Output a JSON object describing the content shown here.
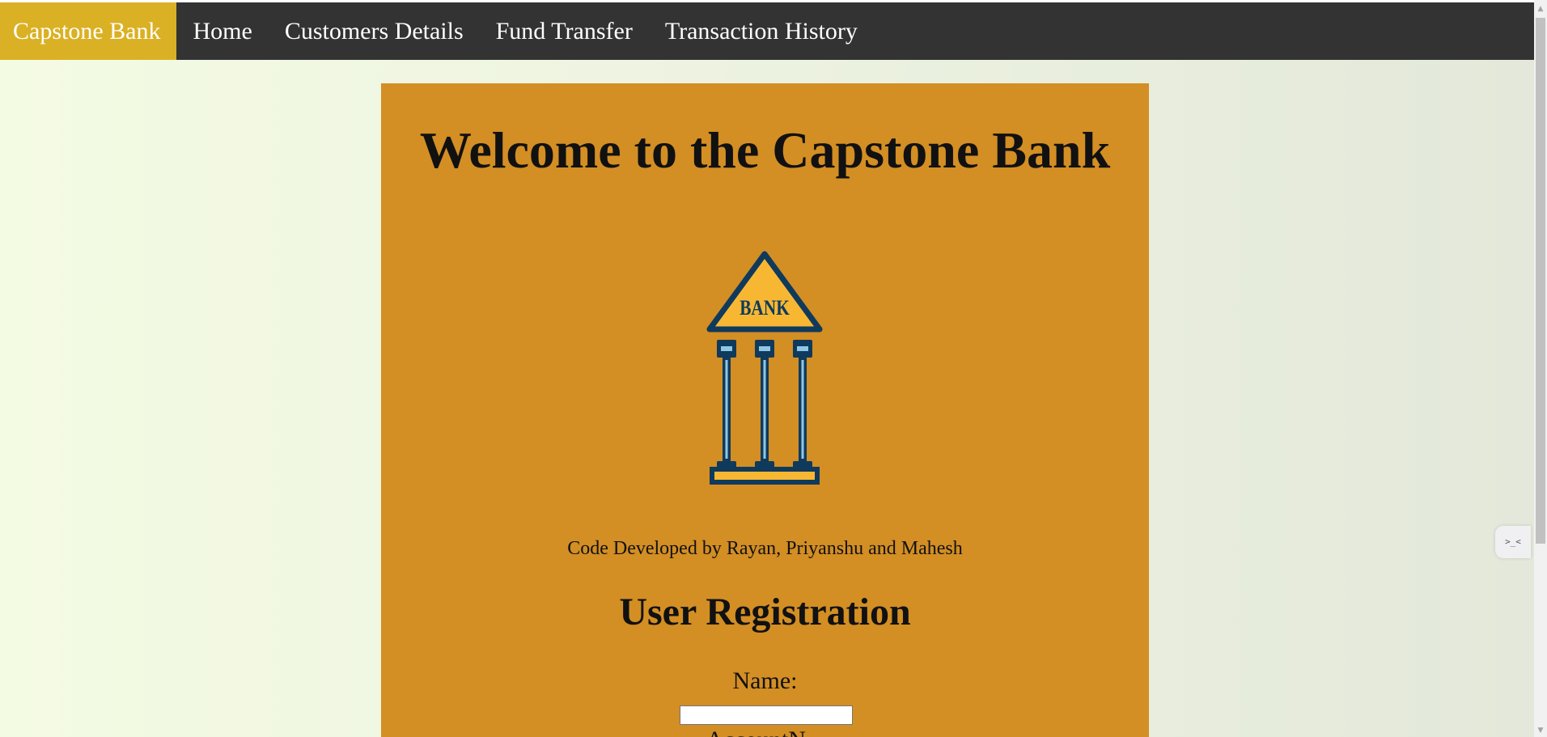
{
  "navbar": {
    "brand": "Capstone Bank",
    "items": [
      {
        "label": "Home"
      },
      {
        "label": "Customers Details"
      },
      {
        "label": "Fund Transfer"
      },
      {
        "label": "Transaction History"
      }
    ]
  },
  "main": {
    "title": "Welcome to the Capstone Bank",
    "logo_text": "BANK",
    "credit": "Code Developed by Rayan, Priyanshu and Mahesh",
    "section_title": "User Registration",
    "form": {
      "name_label": "Name:",
      "name_value": "",
      "next_label_partial": "AccountN..."
    }
  },
  "side_widget": {
    "icon": ">_<"
  },
  "colors": {
    "navbar_bg": "#333333",
    "brand_bg": "#dab124",
    "card_bg": "#d38e24",
    "logo_navy": "#0f3a5c",
    "logo_yellow": "#f8b733",
    "logo_light": "#8fc8e6"
  }
}
